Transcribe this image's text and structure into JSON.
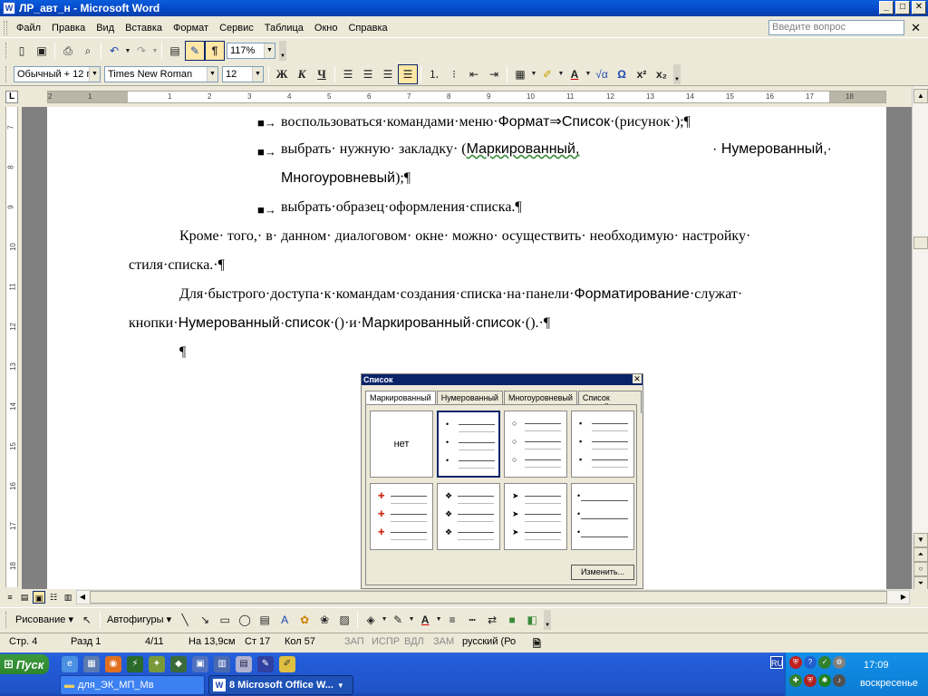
{
  "window": {
    "title": "ЛР_авт_н - Microsoft Word",
    "app_icon": "W",
    "buttons": [
      "_",
      "□",
      "✕"
    ]
  },
  "menu": {
    "items": [
      "Файл",
      "Правка",
      "Вид",
      "Вставка",
      "Формат",
      "Сервис",
      "Таблица",
      "Окно",
      "Справка"
    ],
    "help_placeholder": "Введите вопрос",
    "close_doc": "✕"
  },
  "standard_toolbar": {
    "zoom": "117%",
    "pilcrow": "¶"
  },
  "format_toolbar": {
    "style": "Обычный + 12 г",
    "font": "Times New Roman",
    "size": "12",
    "bold": "Ж",
    "italic": "К",
    "underline": "Ч",
    "font_color_letter": "A",
    "omega": "Ω",
    "superscript": "x²",
    "subscript": "x₂"
  },
  "ruler": {
    "tab_selector": "L",
    "h_ticks": [
      "2",
      "1",
      "1",
      "2",
      "3",
      "4",
      "5",
      "6",
      "7",
      "8",
      "9",
      "10",
      "11",
      "12",
      "13",
      "14",
      "15",
      "16",
      "17",
      "18"
    ],
    "v_ticks": [
      "7",
      "8",
      "9",
      "10",
      "11",
      "12",
      "13",
      "14",
      "15",
      "16",
      "17",
      "18"
    ]
  },
  "document": {
    "bullet1": "воспользоваться·командами·меню·",
    "bullet1_b1": "Формат",
    "bullet1_arrow": "⇒",
    "bullet1_b2": "Список",
    "bullet1_end": "·(рисунок·);¶",
    "bullet2a": "выбрать·  нужную·  закладку·  (",
    "bullet2_b1": "Маркированный,",
    "bullet2_b2": "·  Нумерованный,·",
    "bullet2_line2": "Многоуровневый",
    "bullet2_end": ");¶",
    "bullet3": "выбрать·образец·оформления·списка.¶",
    "para1_line1": "Кроме· того,· в· данном· диалоговом· окне· можно· осуществить· необходимую· настройку·",
    "para1_line2": "стиля·списка.·¶",
    "para2_line1a": "Для·быстрого·доступа·к·командам·создания·списка·на·панели·",
    "para2_b1": "Форматирование",
    "para2_line1b": "·служат·",
    "para2_line2a": "кнопки·",
    "para2_b2": "Нумерованный·список",
    "para2_line2b": "·()·и·",
    "para2_b3": "Маркированный·список",
    "para2_line2c": "·().·¶",
    "empty_para": "¶",
    "bullet_mark": "■→"
  },
  "dialog": {
    "title": "Список",
    "close": "✕",
    "tabs": [
      "Маркированный",
      "Нумерованный",
      "Многоуровневый",
      "Список стилей"
    ],
    "none_label": "нет",
    "change_button": "Изменить...",
    "markers": [
      "•",
      "○",
      "▪",
      "✚",
      "❖",
      "➤",
      "•"
    ]
  },
  "statusbar": {
    "page": "Стр.  4",
    "section": "Разд  1",
    "pages": "4/11",
    "at": "На  13,9см",
    "line": "Ст  17",
    "col": "Кол  57",
    "rec": "ЗАП",
    "trk": "ИСПР",
    "ext": "ВДЛ",
    "ovr": "ЗАМ",
    "lang": "русский (Ро"
  },
  "draw_toolbar": {
    "drawing": "Рисование ▾",
    "autoshapes": "Автофигуры ▾"
  },
  "taskbar": {
    "start": "Пуск",
    "task1": "для_ЭК_МП_Мв",
    "task2": "8 Microsoft Office W...",
    "lang": "RU",
    "time": "17:09",
    "day": "воскресенье"
  }
}
